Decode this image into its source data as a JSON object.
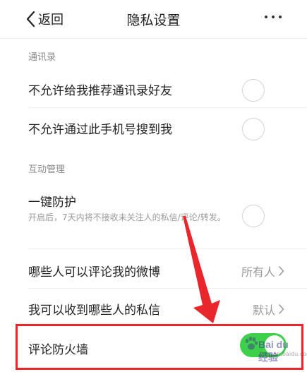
{
  "header": {
    "back_label": "返回",
    "title": "隐私设置"
  },
  "sections": {
    "contacts": "通讯录",
    "interaction": "互动管理"
  },
  "rows": {
    "no_recommend_contacts": {
      "label": "不允许给我推荐通讯录好友",
      "enabled": false
    },
    "no_search_by_phone": {
      "label": "不允许通过此手机号搜到我",
      "enabled": false
    },
    "one_key_protect": {
      "label": "一键防护",
      "desc": "开启后，7天内将不接收未关注人的私信/评论/转发。",
      "enabled": false
    },
    "who_can_comment": {
      "label": "哪些人可以评论我的微博",
      "value": "所有人"
    },
    "who_can_message": {
      "label": "我可以收到哪些人的私信",
      "value": "默认"
    },
    "comment_firewall": {
      "label": "评论防火墙",
      "enabled": true
    }
  },
  "watermark": {
    "text": "Bai du 经验",
    "sub": "jingyan.baidu.com"
  },
  "colors": {
    "highlight": "#e8262b",
    "switch_on": "#3ecf4b",
    "arrow": "#e8262b"
  }
}
